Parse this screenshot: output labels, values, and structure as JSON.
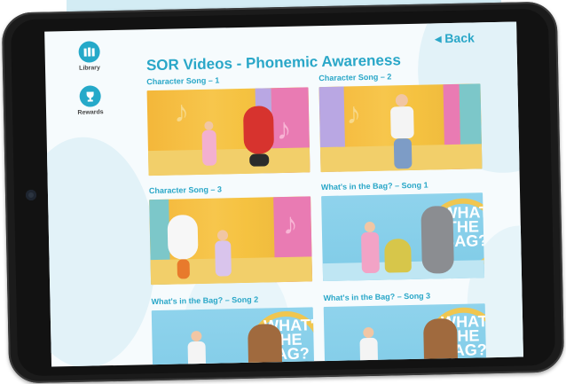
{
  "nav": {
    "library_label": "Library",
    "rewards_label": "Rewards",
    "back_label": "◂ Back"
  },
  "page": {
    "title": "SOR Videos - Phonemic Awareness"
  },
  "videos": [
    {
      "title": "Character Song – 1"
    },
    {
      "title": "Character Song – 2"
    },
    {
      "title": "Character Song – 3"
    },
    {
      "title": "What's in the Bag? – Song 1",
      "overlay": "WHAT'S THE BAG?"
    },
    {
      "title": "What's in the Bag? – Song 2",
      "overlay": "WHAT'S THE BAG?"
    },
    {
      "title": "What's in the Bag? – Song 3",
      "overlay": "WHAT'S THE BAG?"
    }
  ],
  "colors": {
    "accent": "#2aa7c8",
    "bezel": "#1b1b1b",
    "screen_bg": "#f6fbfd"
  },
  "icons": {
    "library": "library-icon",
    "rewards": "rewards-icon"
  }
}
